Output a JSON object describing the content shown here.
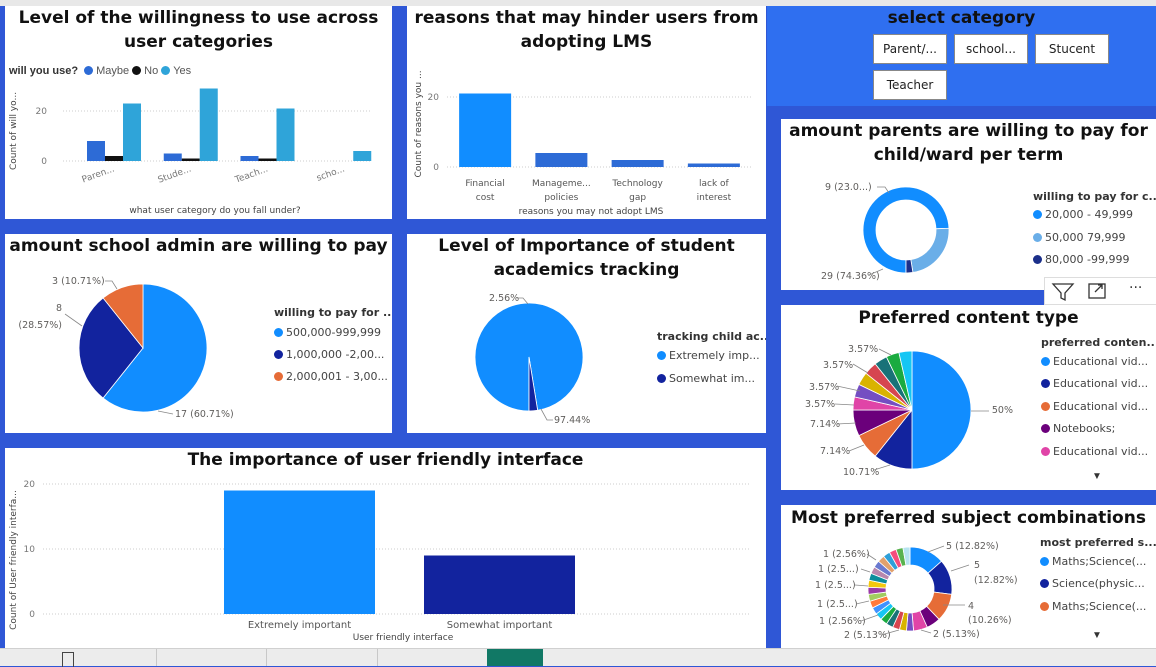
{
  "colors": {
    "blue": "#118dff",
    "navy": "#12239e",
    "orange": "#e66c37",
    "black": "#111111",
    "mid_blue": "#2d6bd6",
    "cyan": "#2fa4d9",
    "light_blue": "#6aaee8",
    "dark_navy": "#1b2f8a",
    "purple": "#6b007b",
    "pink": "#e044a7",
    "teal": "#197278",
    "yellow": "#d9b300"
  },
  "slicer": {
    "title": "select category",
    "options": [
      "Parent/...",
      "school...",
      "Stucent",
      "Teacher"
    ]
  },
  "toolbar": {
    "filter_icon": "filter-icon",
    "focus_icon": "focus-mode-icon",
    "more_label": "···"
  },
  "chart_data": [
    {
      "id": "willingness",
      "type": "bar",
      "title_line1": "Level of the willingness to use across",
      "title_line2": "user categories",
      "legend_title": "will you use?",
      "categories": [
        "Paren...",
        "Stude...",
        "Teach...",
        "scho..."
      ],
      "series": [
        {
          "name": "Maybe",
          "values": [
            8,
            3,
            2,
            0
          ]
        },
        {
          "name": "No",
          "values": [
            2,
            1,
            1,
            0
          ]
        },
        {
          "name": "Yes",
          "values": [
            23,
            29,
            21,
            4
          ]
        }
      ],
      "xlabel": "what user category do you fall under?",
      "ylabel": "Count of will yo...",
      "yticks": [
        0,
        20
      ],
      "ylim": [
        0,
        30
      ],
      "legend": "top-left"
    },
    {
      "id": "hinder",
      "type": "bar",
      "title_line1": "reasons that may hinder users from",
      "title_line2": "adopting LMS",
      "categories": [
        "Financial cost",
        "Manageme... policies",
        "Technology gap",
        "lack of interest"
      ],
      "category_lines": [
        [
          "Financial",
          "cost"
        ],
        [
          "Manageme...",
          "policies"
        ],
        [
          "Technology",
          "gap"
        ],
        [
          "lack of",
          "interest"
        ]
      ],
      "values": [
        21,
        4,
        2,
        1
      ],
      "xlabel": "reasons you may not adopt LMS",
      "ylabel": "Count of reasons you ...",
      "yticks": [
        0,
        20
      ],
      "ylim": [
        0,
        26
      ]
    },
    {
      "id": "parents_pay",
      "type": "pie",
      "donut": true,
      "title_line1": "amount parents are willing to pay for",
      "title_line2": "child/ward per term",
      "legend_title": "willing to pay for c...",
      "slices": [
        {
          "label": "20,000 - 49,999",
          "value": 29
        },
        {
          "label": "50,000 79,999",
          "value": 9
        },
        {
          "label": "80,000 -99,999",
          "value": 1
        }
      ],
      "data_labels": [
        "29 (74.36%)",
        "9 (23.0...)"
      ]
    },
    {
      "id": "admin_pay",
      "type": "pie",
      "title": "amount school admin are willing to pay",
      "legend_title": "willing to pay for ...",
      "slices": [
        {
          "label": "500,000-999,999",
          "value": 17
        },
        {
          "label": "1,000,000 -2,00...",
          "value": 8
        },
        {
          "label": "2,000,001 - 3,00...",
          "value": 3
        }
      ],
      "data_labels": [
        "17 (60.71%)",
        "8",
        "(28.57%)",
        "3 (10.71%)"
      ]
    },
    {
      "id": "tracking",
      "type": "pie",
      "title_line1": "Level of Importance of student",
      "title_line2": "academics tracking",
      "legend_title": "tracking child ac...",
      "slices": [
        {
          "label": "Extremely imp...",
          "value": 97.44
        },
        {
          "label": "Somewhat im...",
          "value": 2.56
        }
      ],
      "data_labels": [
        "97.44%",
        "2.56%"
      ]
    },
    {
      "id": "content",
      "type": "pie",
      "title": "Preferred content type",
      "legend_title": "preferred conten...",
      "legend_items": [
        "Educational vid...",
        "Educational vid...",
        "Educational vid...",
        "Notebooks;",
        "Educational vid..."
      ],
      "slices": [
        50,
        10.71,
        7.14,
        7.14,
        3.57,
        3.57,
        3.57,
        3.57,
        3.57,
        3.57,
        3.57
      ],
      "data_labels": [
        "50%",
        "10.71%",
        "7.14%",
        "7.14%",
        "3.57%",
        "3.57%",
        "3.57%",
        "3.57%"
      ]
    },
    {
      "id": "subjects",
      "type": "pie",
      "donut": true,
      "title": "Most preferred subject combinations",
      "legend_title": "most preferred s...",
      "legend_items": [
        "Maths;Science(...",
        "Science(physic...",
        "Maths;Science(..."
      ],
      "slices": [
        5,
        5,
        4,
        2,
        2,
        1,
        1,
        1,
        1,
        1,
        1,
        1,
        1,
        1,
        1,
        1,
        1,
        1,
        1,
        1,
        1,
        1,
        1,
        1
      ],
      "data_labels": [
        "5 (12.82%)",
        "5",
        "(12.82%)",
        "4",
        "(10.26%)",
        "2 (5.13%)",
        "2 (5.13%)",
        "1 (2.56%)",
        "1 (2.5...)",
        "1 (2.5...)",
        "1 (2.5...)",
        "1 (2.56%)"
      ]
    },
    {
      "id": "friendly",
      "type": "bar",
      "title": "The importance of user friendly interface",
      "categories": [
        "Extremely important",
        "Somewhat important"
      ],
      "values": [
        19,
        9
      ],
      "xlabel": "User friendly interface",
      "ylabel": "Count of User friendly interfa...",
      "yticks": [
        0,
        10,
        20
      ],
      "ylim": [
        0,
        21
      ]
    }
  ]
}
